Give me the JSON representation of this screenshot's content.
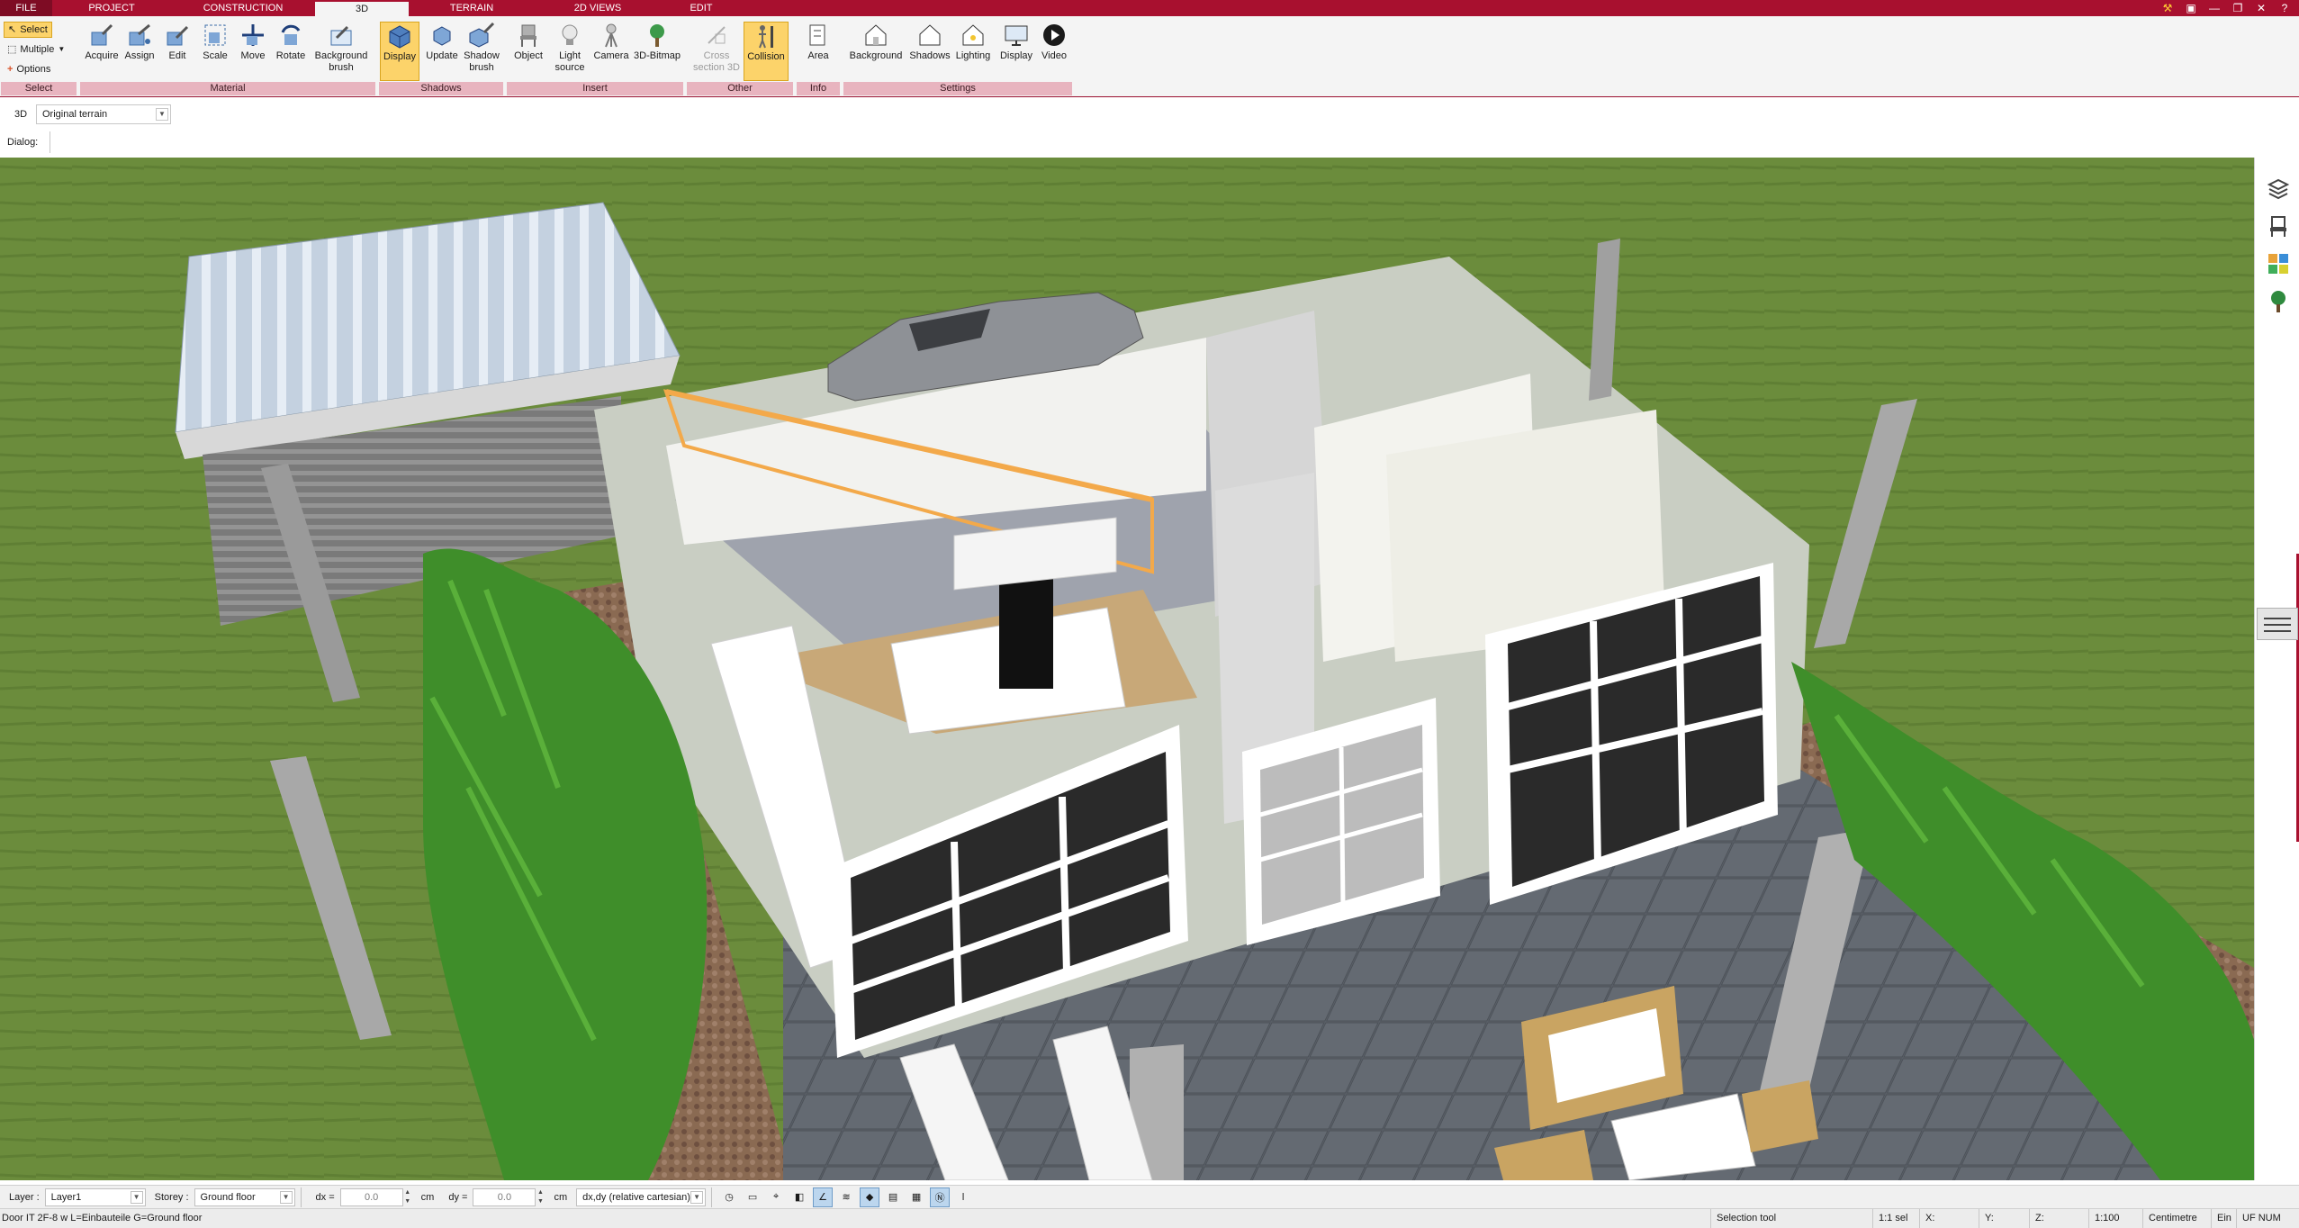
{
  "tabs": [
    {
      "id": "file",
      "label": "FILE"
    },
    {
      "id": "project",
      "label": "PROJECT"
    },
    {
      "id": "construction",
      "label": "CONSTRUCTION"
    },
    {
      "id": "3d",
      "label": "3D"
    },
    {
      "id": "terrain",
      "label": "TERRAIN"
    },
    {
      "id": "2dviews",
      "label": "2D VIEWS"
    },
    {
      "id": "edit",
      "label": "EDIT"
    }
  ],
  "active_tab": "3D",
  "ribbon": {
    "select": {
      "group_label": "Select",
      "select_label": "Select",
      "multiple_label": "Multiple",
      "options_label": "Options"
    },
    "material": {
      "group_label": "Material",
      "buttons": [
        "Acquire",
        "Assign",
        "Edit",
        "Scale",
        "Move",
        "Rotate",
        "Background brush"
      ]
    },
    "shadows": {
      "group_label": "Shadows",
      "buttons": [
        "Display",
        "Update",
        "Shadow brush"
      ]
    },
    "insert": {
      "group_label": "Insert",
      "buttons": [
        "Object",
        "Light source",
        "Camera",
        "3D-Bitmap"
      ]
    },
    "other": {
      "group_label": "Other",
      "buttons": [
        "Cross section 3D",
        "Collision"
      ]
    },
    "info": {
      "group_label": "Info",
      "buttons": [
        "Area"
      ]
    },
    "settings": {
      "group_label": "Settings",
      "buttons": [
        "Background",
        "Shadows",
        "Lighting",
        "Display",
        "Video"
      ]
    }
  },
  "viewbar": {
    "view_label": "3D",
    "terrain_value": "Original terrain",
    "dialog_label": "Dialog:"
  },
  "layerbar": {
    "layer_label": "Layer :",
    "layer_value": "Layer1",
    "storey_label": "Storey :",
    "storey_value": "Ground floor",
    "dx_label": "dx =",
    "dx_value": "0.0",
    "dx_unit": "cm",
    "dy_label": "dy =",
    "dy_value": "0.0",
    "dy_unit": "cm",
    "coord_mode": "dx,dy (relative cartesian)"
  },
  "statusbar": {
    "hint": "Door IT 2F-8 w L=Einbauteile G=Ground floor",
    "tool": "Selection tool",
    "selection": "1:1 sel",
    "x_label": "X:",
    "y_label": "Y:",
    "z_label": "Z:",
    "scale": "1:100",
    "unit": "Centimetre",
    "mode": "Ein",
    "flags": "UF NUM"
  },
  "colors": {
    "brand": "#a8102f",
    "active_button": "#fcd36a",
    "group_label_bg": "#e8b4bf"
  }
}
